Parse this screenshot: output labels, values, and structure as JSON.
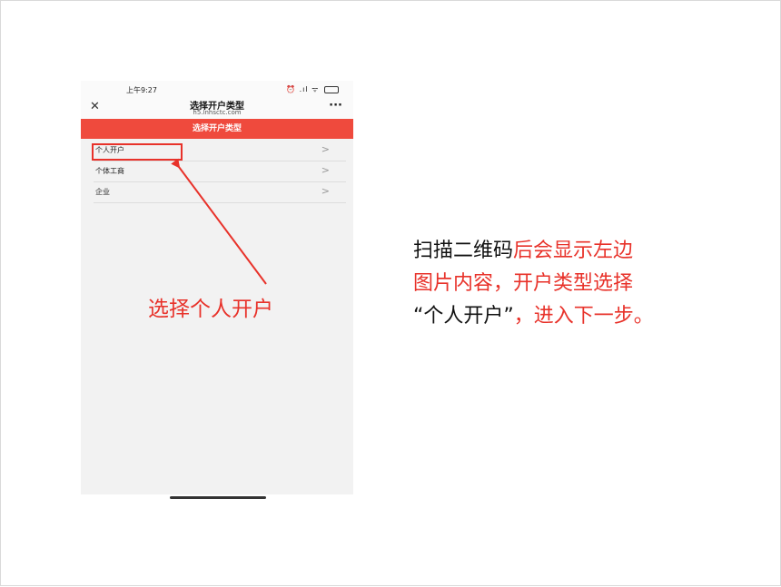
{
  "phone": {
    "status_time": "上午9:27",
    "status_icons": "⏰ .ıl ᯤ",
    "title": "选择开户类型",
    "url": "h5.lnhsctc.com",
    "header": "选择开户类型",
    "items": [
      {
        "label": "个人开户",
        "chevron": ">"
      },
      {
        "label": "个体工商",
        "chevron": ">"
      },
      {
        "label": "企业",
        "chevron": ">"
      }
    ],
    "close_glyph": "✕",
    "more_glyph": "···"
  },
  "annotation": {
    "label": "选择个人开户",
    "color": "#e8322a"
  },
  "instructions": {
    "line1_black": "扫描二维码",
    "line1_red": "后会显示左边",
    "line2_red": "图片内容，开户类型选择",
    "line3_black": "“个人开户”",
    "line3_red": "，进入下一步。"
  },
  "colors": {
    "header_red": "#ef4a3d",
    "accent_red": "#e8322a"
  }
}
